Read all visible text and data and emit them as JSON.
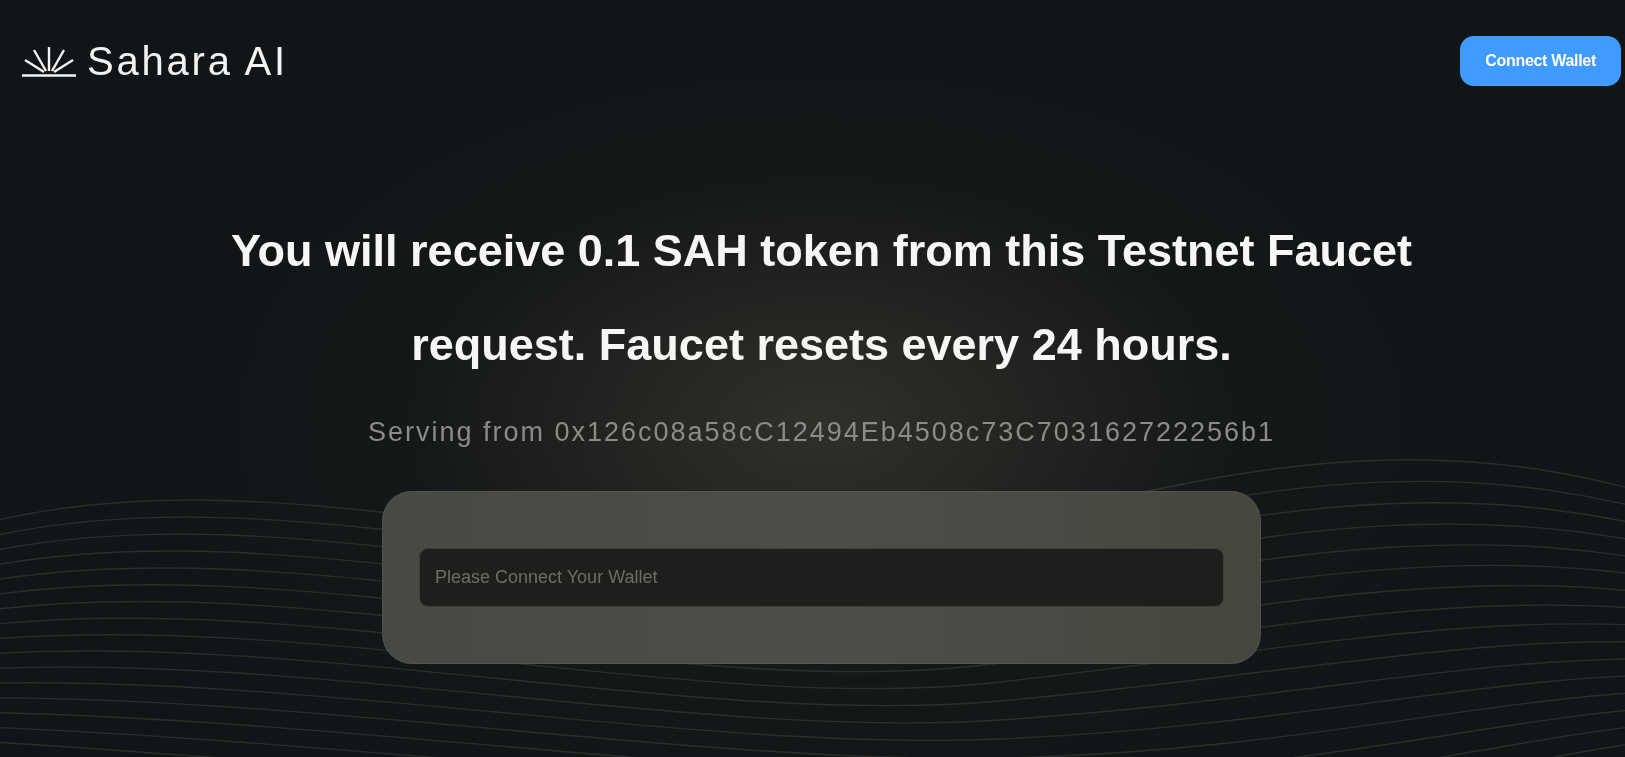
{
  "header": {
    "logo": {
      "text": "Sahara AI"
    },
    "connect_button": {
      "label": "Connect Wallet"
    }
  },
  "main": {
    "heading": "You will receive 0.1 SAH token from this Testnet Faucet request. Faucet resets every 24 hours.",
    "serving_text": "Serving from 0x126c08a58cC12494Eb4508c73C703162722256b1",
    "address_field": {
      "placeholder": "Please Connect Your Wallet"
    }
  }
}
